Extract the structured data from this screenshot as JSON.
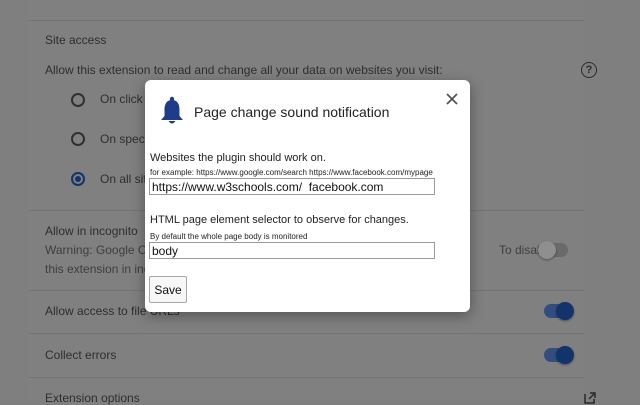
{
  "background": {
    "site_access": {
      "heading": "Site access",
      "description": "Allow this extension to read and change all your data on websites you visit:",
      "options": [
        {
          "label": "On click",
          "checked": false
        },
        {
          "label": "On specif",
          "checked": false
        },
        {
          "label": "On all sit",
          "checked": true
        }
      ]
    },
    "incognito": {
      "heading": "Allow in incognito",
      "warning_line1": "Warning: Google Chr",
      "warning_right": "To disable",
      "warning_line2": "this extension in inco",
      "enabled": false
    },
    "file_urls": {
      "label": "Allow access to file URLs",
      "enabled": true
    },
    "collect_errors": {
      "label": "Collect errors",
      "enabled": true
    },
    "extension_options": {
      "label": "Extension options"
    }
  },
  "dialog": {
    "title": "Page change sound notification",
    "websites": {
      "label": "Websites the plugin should work on.",
      "hint": "for example: https://www.google.com/search https://www.facebook.com/mypage",
      "value": "https://www.w3schools.com/  facebook.com"
    },
    "selector": {
      "label": "HTML page element selector to observe for changes.",
      "hint": "By default the whole page body is monitored",
      "value": "body"
    },
    "save_label": "Save"
  },
  "colors": {
    "accent": "#1a73e8",
    "overlay": "#7f7f7f",
    "bell": "#1f3c88"
  },
  "icons": [
    "bell-icon",
    "close-icon",
    "help-icon",
    "open-external-icon"
  ]
}
